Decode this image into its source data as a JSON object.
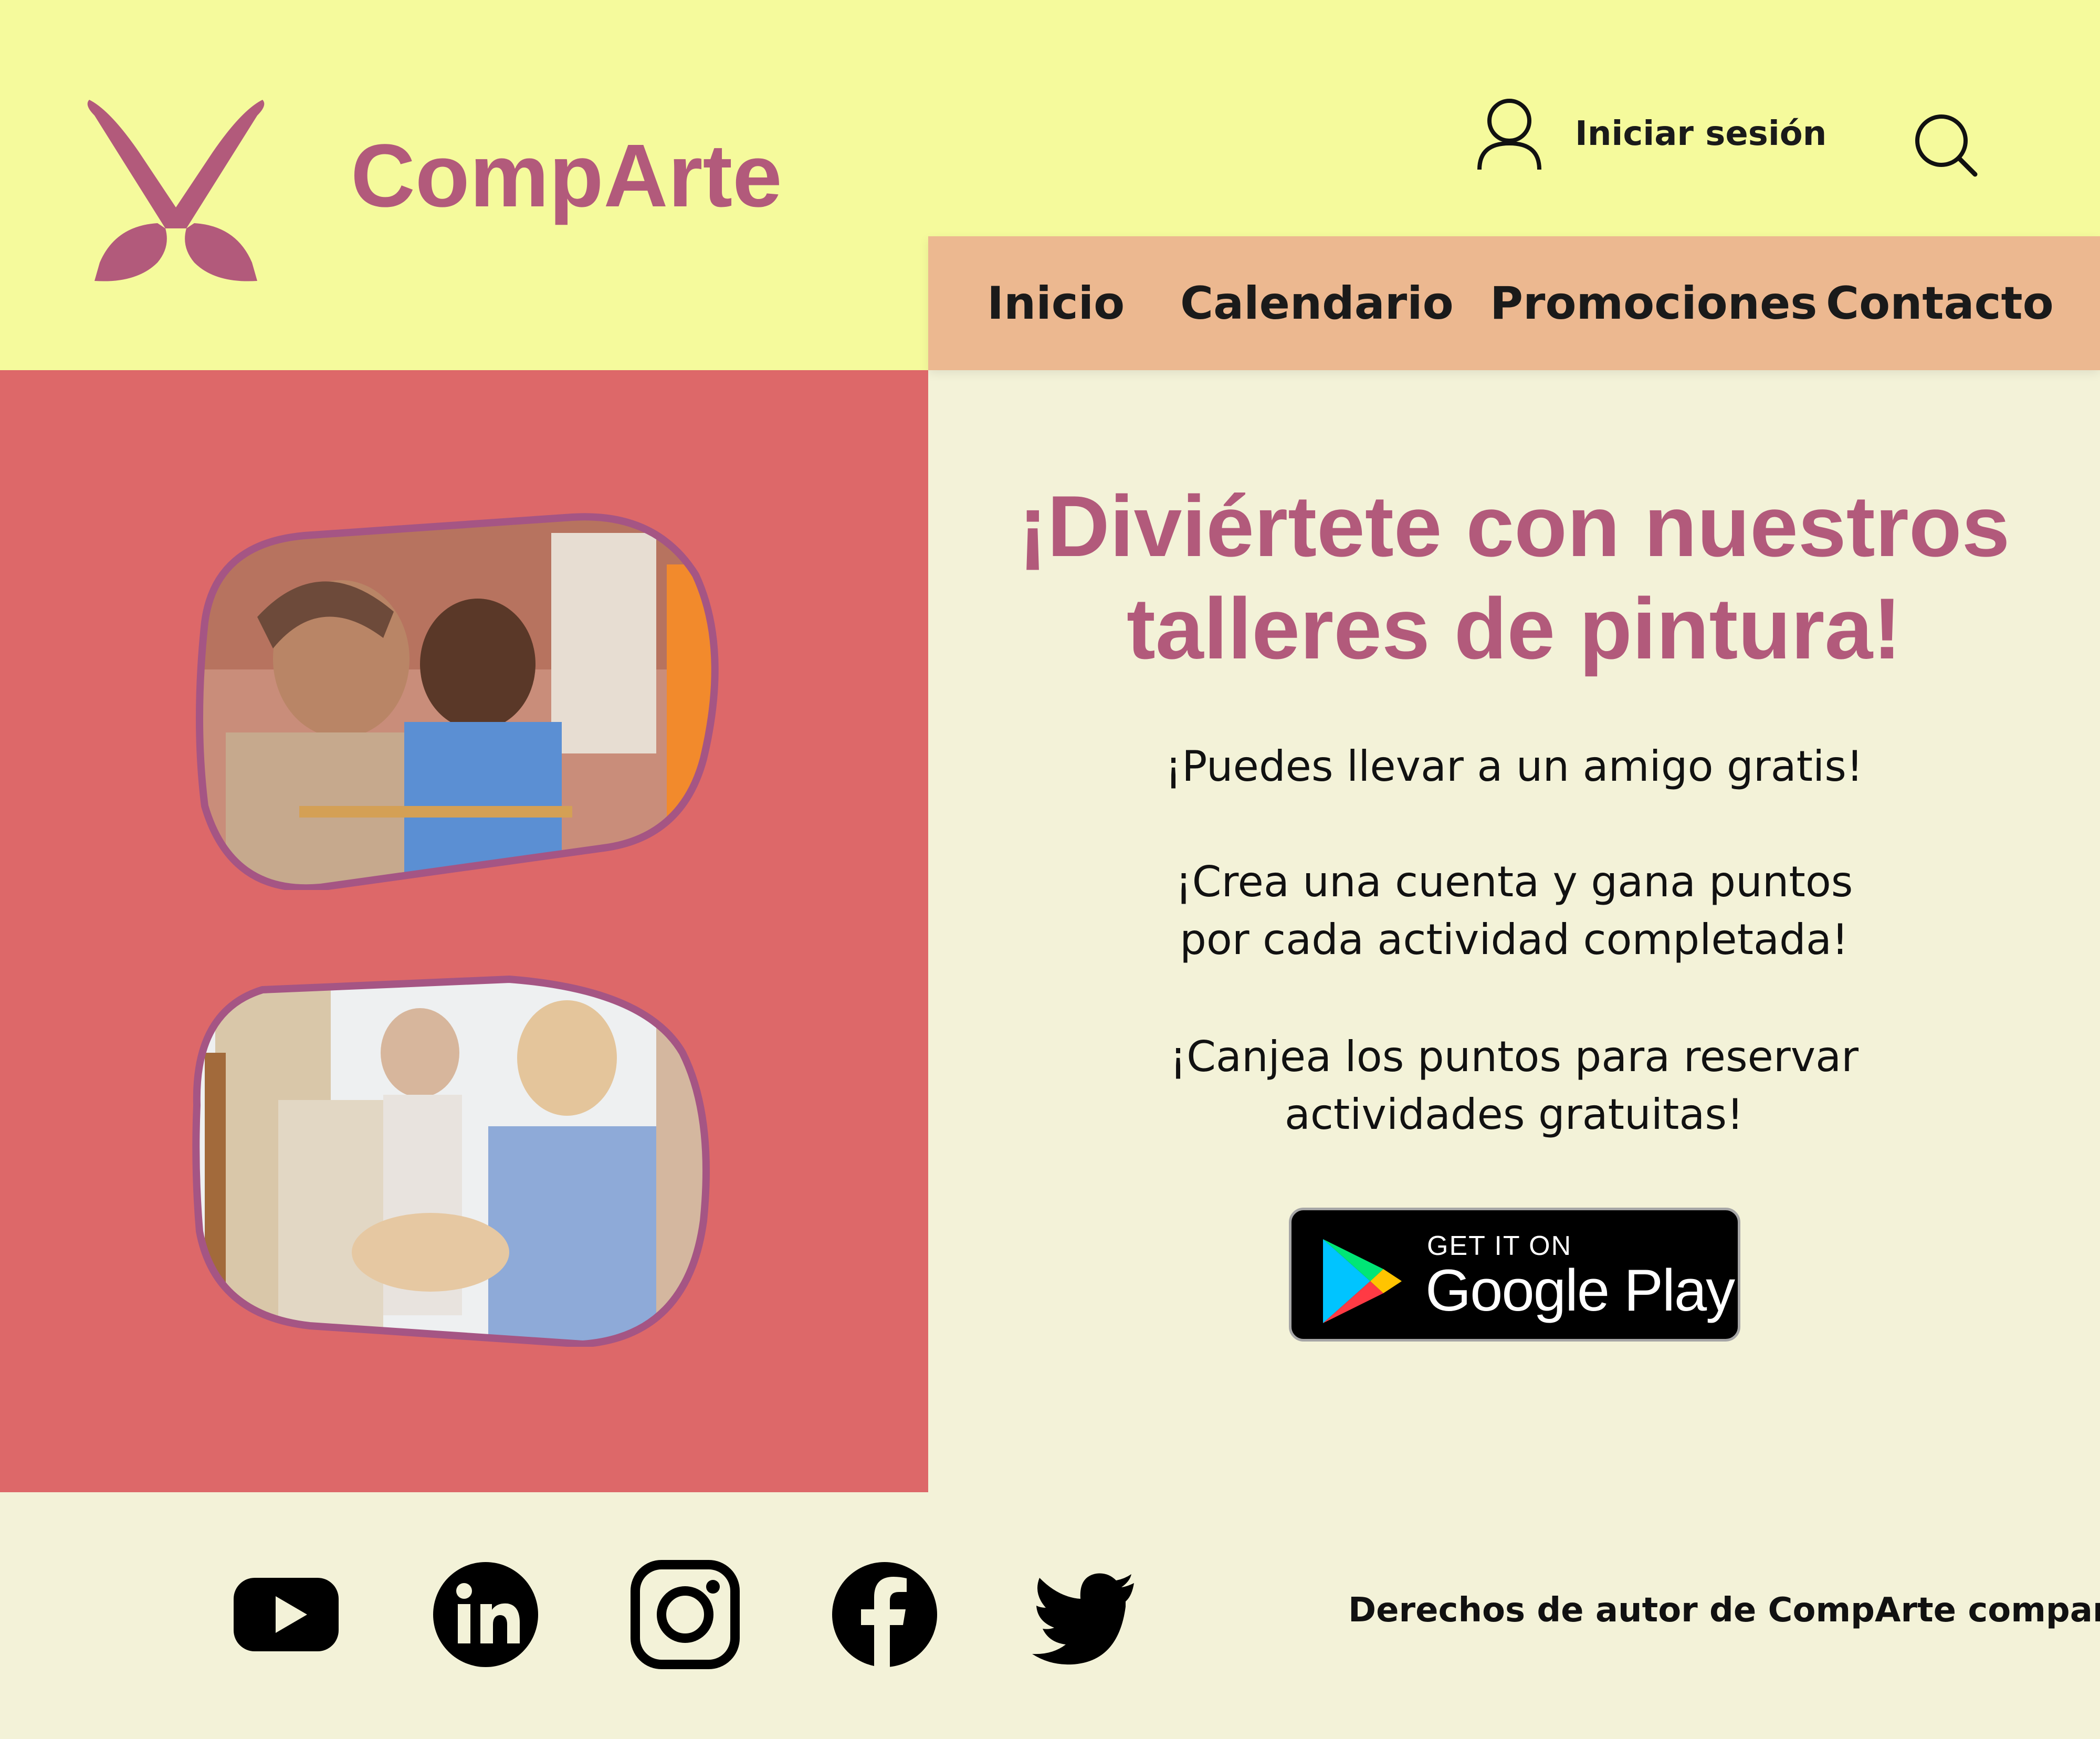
{
  "header": {
    "brand": "CompArte",
    "login_label": "Iniciar sesión"
  },
  "nav": {
    "items": [
      "Inicio",
      "Calendario",
      "Promociones",
      "Contacto"
    ]
  },
  "main": {
    "headline_line1": "¡Diviértete con nuestros",
    "headline_line2": "talleres de pintura!",
    "paragraph1": "¡Puedes llevar a un amigo gratis!",
    "paragraph2": "¡Crea una cuenta y gana puntos\npor cada actividad completada!",
    "paragraph3": "¡Canjea los puntos para reservar\nactividades gratuitas!"
  },
  "store_badge": {
    "small_text": "GET IT ON",
    "big_text": "Google Play"
  },
  "footer": {
    "social_icons": [
      "youtube-icon",
      "linkedin-icon",
      "instagram-icon",
      "facebook-icon",
      "twitter-icon"
    ],
    "copyright": "Derechos de autor de CompArte company"
  },
  "colors": {
    "header_bg": "#f5fa9c",
    "nav_bg": "#ecb890",
    "left_panel_bg": "#dd6869",
    "content_bg": "#f3f2d8",
    "brand": "#b25a7b"
  }
}
